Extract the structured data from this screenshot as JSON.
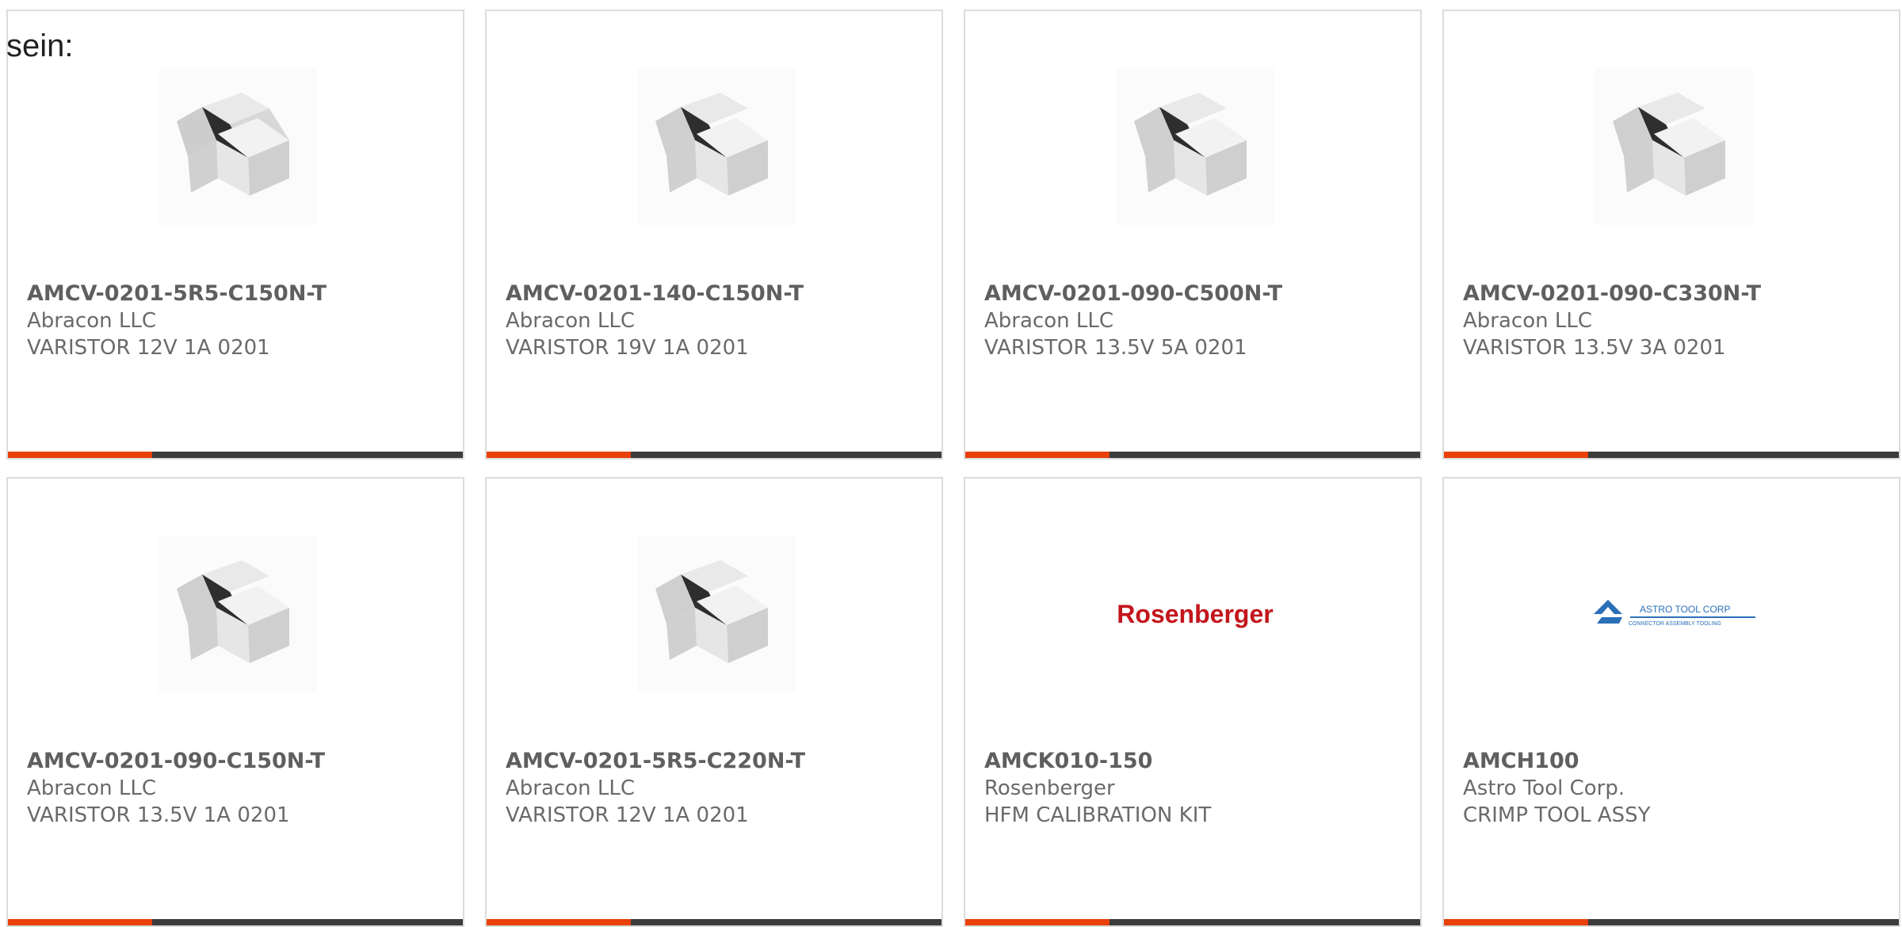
{
  "intro_text": "sein:",
  "colors": {
    "accent": "#e8410a",
    "bar_dark": "#3c3c3c",
    "rosenberger_red": "#c3161c",
    "astro_blue": "#1f6fb5"
  },
  "products": [
    {
      "part_number": "AMCV-0201-5R5-C150N-T",
      "manufacturer": "Abracon LLC",
      "description": "VARISTOR 12V 1A 0201",
      "image": "chip-component-image"
    },
    {
      "part_number": "AMCV-0201-140-C150N-T",
      "manufacturer": "Abracon LLC",
      "description": "VARISTOR 19V 1A 0201",
      "image": "chip-component-image"
    },
    {
      "part_number": "AMCV-0201-090-C500N-T",
      "manufacturer": "Abracon LLC",
      "description": "VARISTOR 13.5V 5A 0201",
      "image": "chip-component-image"
    },
    {
      "part_number": "AMCV-0201-090-C330N-T",
      "manufacturer": "Abracon LLC",
      "description": "VARISTOR 13.5V 3A 0201",
      "image": "chip-component-image"
    },
    {
      "part_number": "AMCV-0201-090-C150N-T",
      "manufacturer": "Abracon LLC",
      "description": "VARISTOR 13.5V 1A 0201",
      "image": "chip-component-image"
    },
    {
      "part_number": "AMCV-0201-5R5-C220N-T",
      "manufacturer": "Abracon LLC",
      "description": "VARISTOR 12V 1A 0201",
      "image": "chip-component-image"
    },
    {
      "part_number": "AMCK010-150",
      "manufacturer": "Rosenberger",
      "description": "HFM CALIBRATION KIT",
      "image": "rosenberger-logo",
      "logo_text": "Rosenberger"
    },
    {
      "part_number": "AMCH100",
      "manufacturer": "Astro Tool Corp.",
      "description": "CRIMP TOOL ASSY",
      "image": "astro-tool-corp-logo",
      "logo_text": "ASTRO TOOL CORP",
      "logo_subtext": "CONNECTOR ASSEMBLY TOOLING"
    }
  ]
}
